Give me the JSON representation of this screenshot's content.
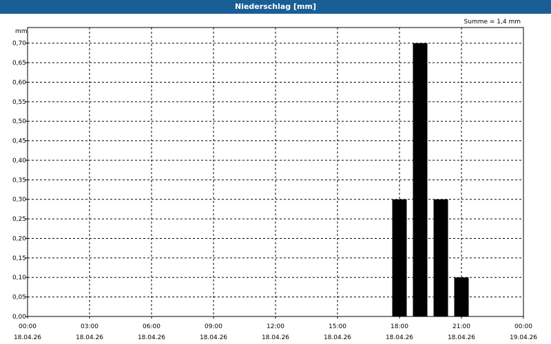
{
  "window": {
    "title": "Niederschlag [mm]"
  },
  "chart_data": {
    "type": "bar",
    "title": "Niederschlag [mm]",
    "summary": "Summe = 1,4 mm",
    "ylabel": "mm",
    "ylim": [
      0,
      0.74
    ],
    "yticks": [
      "0,00",
      "0,05",
      "0,10",
      "0,15",
      "0,20",
      "0,25",
      "0,30",
      "0,35",
      "0,40",
      "0,45",
      "0,50",
      "0,55",
      "0,60",
      "0,65",
      "0,70"
    ],
    "xlim_hours": [
      0,
      24
    ],
    "xticks": [
      {
        "time": "00:00",
        "date": "18.04.26"
      },
      {
        "time": "03:00",
        "date": "18.04.26"
      },
      {
        "time": "06:00",
        "date": "18.04.26"
      },
      {
        "time": "09:00",
        "date": "18.04.26"
      },
      {
        "time": "12:00",
        "date": "18.04.26"
      },
      {
        "time": "15:00",
        "date": "18.04.26"
      },
      {
        "time": "18:00",
        "date": "18.04.26"
      },
      {
        "time": "21:00",
        "date": "18.04.26"
      },
      {
        "time": "00:00",
        "date": "19.04.26"
      }
    ],
    "bars": [
      {
        "hour": 18,
        "value": 0.3
      },
      {
        "hour": 19,
        "value": 0.7
      },
      {
        "hour": 20,
        "value": 0.3
      },
      {
        "hour": 21,
        "value": 0.1
      }
    ],
    "grid": true,
    "bar_color": "#000000"
  }
}
